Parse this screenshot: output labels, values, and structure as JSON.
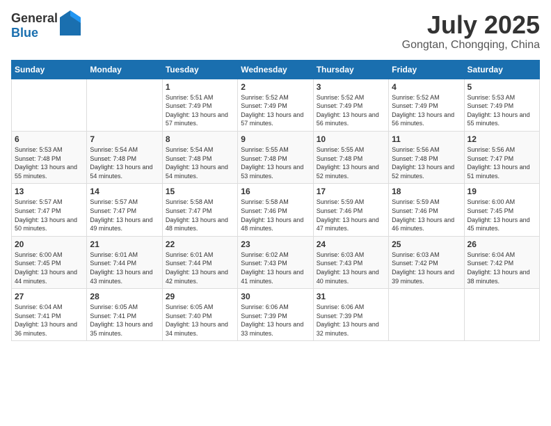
{
  "header": {
    "logo_general": "General",
    "logo_blue": "Blue",
    "month": "July 2025",
    "location": "Gongtan, Chongqing, China"
  },
  "weekdays": [
    "Sunday",
    "Monday",
    "Tuesday",
    "Wednesday",
    "Thursday",
    "Friday",
    "Saturday"
  ],
  "weeks": [
    [
      {
        "day": "",
        "info": ""
      },
      {
        "day": "",
        "info": ""
      },
      {
        "day": "1",
        "info": "Sunrise: 5:51 AM\nSunset: 7:49 PM\nDaylight: 13 hours and 57 minutes."
      },
      {
        "day": "2",
        "info": "Sunrise: 5:52 AM\nSunset: 7:49 PM\nDaylight: 13 hours and 57 minutes."
      },
      {
        "day": "3",
        "info": "Sunrise: 5:52 AM\nSunset: 7:49 PM\nDaylight: 13 hours and 56 minutes."
      },
      {
        "day": "4",
        "info": "Sunrise: 5:52 AM\nSunset: 7:49 PM\nDaylight: 13 hours and 56 minutes."
      },
      {
        "day": "5",
        "info": "Sunrise: 5:53 AM\nSunset: 7:49 PM\nDaylight: 13 hours and 55 minutes."
      }
    ],
    [
      {
        "day": "6",
        "info": "Sunrise: 5:53 AM\nSunset: 7:48 PM\nDaylight: 13 hours and 55 minutes."
      },
      {
        "day": "7",
        "info": "Sunrise: 5:54 AM\nSunset: 7:48 PM\nDaylight: 13 hours and 54 minutes."
      },
      {
        "day": "8",
        "info": "Sunrise: 5:54 AM\nSunset: 7:48 PM\nDaylight: 13 hours and 54 minutes."
      },
      {
        "day": "9",
        "info": "Sunrise: 5:55 AM\nSunset: 7:48 PM\nDaylight: 13 hours and 53 minutes."
      },
      {
        "day": "10",
        "info": "Sunrise: 5:55 AM\nSunset: 7:48 PM\nDaylight: 13 hours and 52 minutes."
      },
      {
        "day": "11",
        "info": "Sunrise: 5:56 AM\nSunset: 7:48 PM\nDaylight: 13 hours and 52 minutes."
      },
      {
        "day": "12",
        "info": "Sunrise: 5:56 AM\nSunset: 7:47 PM\nDaylight: 13 hours and 51 minutes."
      }
    ],
    [
      {
        "day": "13",
        "info": "Sunrise: 5:57 AM\nSunset: 7:47 PM\nDaylight: 13 hours and 50 minutes."
      },
      {
        "day": "14",
        "info": "Sunrise: 5:57 AM\nSunset: 7:47 PM\nDaylight: 13 hours and 49 minutes."
      },
      {
        "day": "15",
        "info": "Sunrise: 5:58 AM\nSunset: 7:47 PM\nDaylight: 13 hours and 48 minutes."
      },
      {
        "day": "16",
        "info": "Sunrise: 5:58 AM\nSunset: 7:46 PM\nDaylight: 13 hours and 48 minutes."
      },
      {
        "day": "17",
        "info": "Sunrise: 5:59 AM\nSunset: 7:46 PM\nDaylight: 13 hours and 47 minutes."
      },
      {
        "day": "18",
        "info": "Sunrise: 5:59 AM\nSunset: 7:46 PM\nDaylight: 13 hours and 46 minutes."
      },
      {
        "day": "19",
        "info": "Sunrise: 6:00 AM\nSunset: 7:45 PM\nDaylight: 13 hours and 45 minutes."
      }
    ],
    [
      {
        "day": "20",
        "info": "Sunrise: 6:00 AM\nSunset: 7:45 PM\nDaylight: 13 hours and 44 minutes."
      },
      {
        "day": "21",
        "info": "Sunrise: 6:01 AM\nSunset: 7:44 PM\nDaylight: 13 hours and 43 minutes."
      },
      {
        "day": "22",
        "info": "Sunrise: 6:01 AM\nSunset: 7:44 PM\nDaylight: 13 hours and 42 minutes."
      },
      {
        "day": "23",
        "info": "Sunrise: 6:02 AM\nSunset: 7:43 PM\nDaylight: 13 hours and 41 minutes."
      },
      {
        "day": "24",
        "info": "Sunrise: 6:03 AM\nSunset: 7:43 PM\nDaylight: 13 hours and 40 minutes."
      },
      {
        "day": "25",
        "info": "Sunrise: 6:03 AM\nSunset: 7:42 PM\nDaylight: 13 hours and 39 minutes."
      },
      {
        "day": "26",
        "info": "Sunrise: 6:04 AM\nSunset: 7:42 PM\nDaylight: 13 hours and 38 minutes."
      }
    ],
    [
      {
        "day": "27",
        "info": "Sunrise: 6:04 AM\nSunset: 7:41 PM\nDaylight: 13 hours and 36 minutes."
      },
      {
        "day": "28",
        "info": "Sunrise: 6:05 AM\nSunset: 7:41 PM\nDaylight: 13 hours and 35 minutes."
      },
      {
        "day": "29",
        "info": "Sunrise: 6:05 AM\nSunset: 7:40 PM\nDaylight: 13 hours and 34 minutes."
      },
      {
        "day": "30",
        "info": "Sunrise: 6:06 AM\nSunset: 7:39 PM\nDaylight: 13 hours and 33 minutes."
      },
      {
        "day": "31",
        "info": "Sunrise: 6:06 AM\nSunset: 7:39 PM\nDaylight: 13 hours and 32 minutes."
      },
      {
        "day": "",
        "info": ""
      },
      {
        "day": "",
        "info": ""
      }
    ]
  ]
}
